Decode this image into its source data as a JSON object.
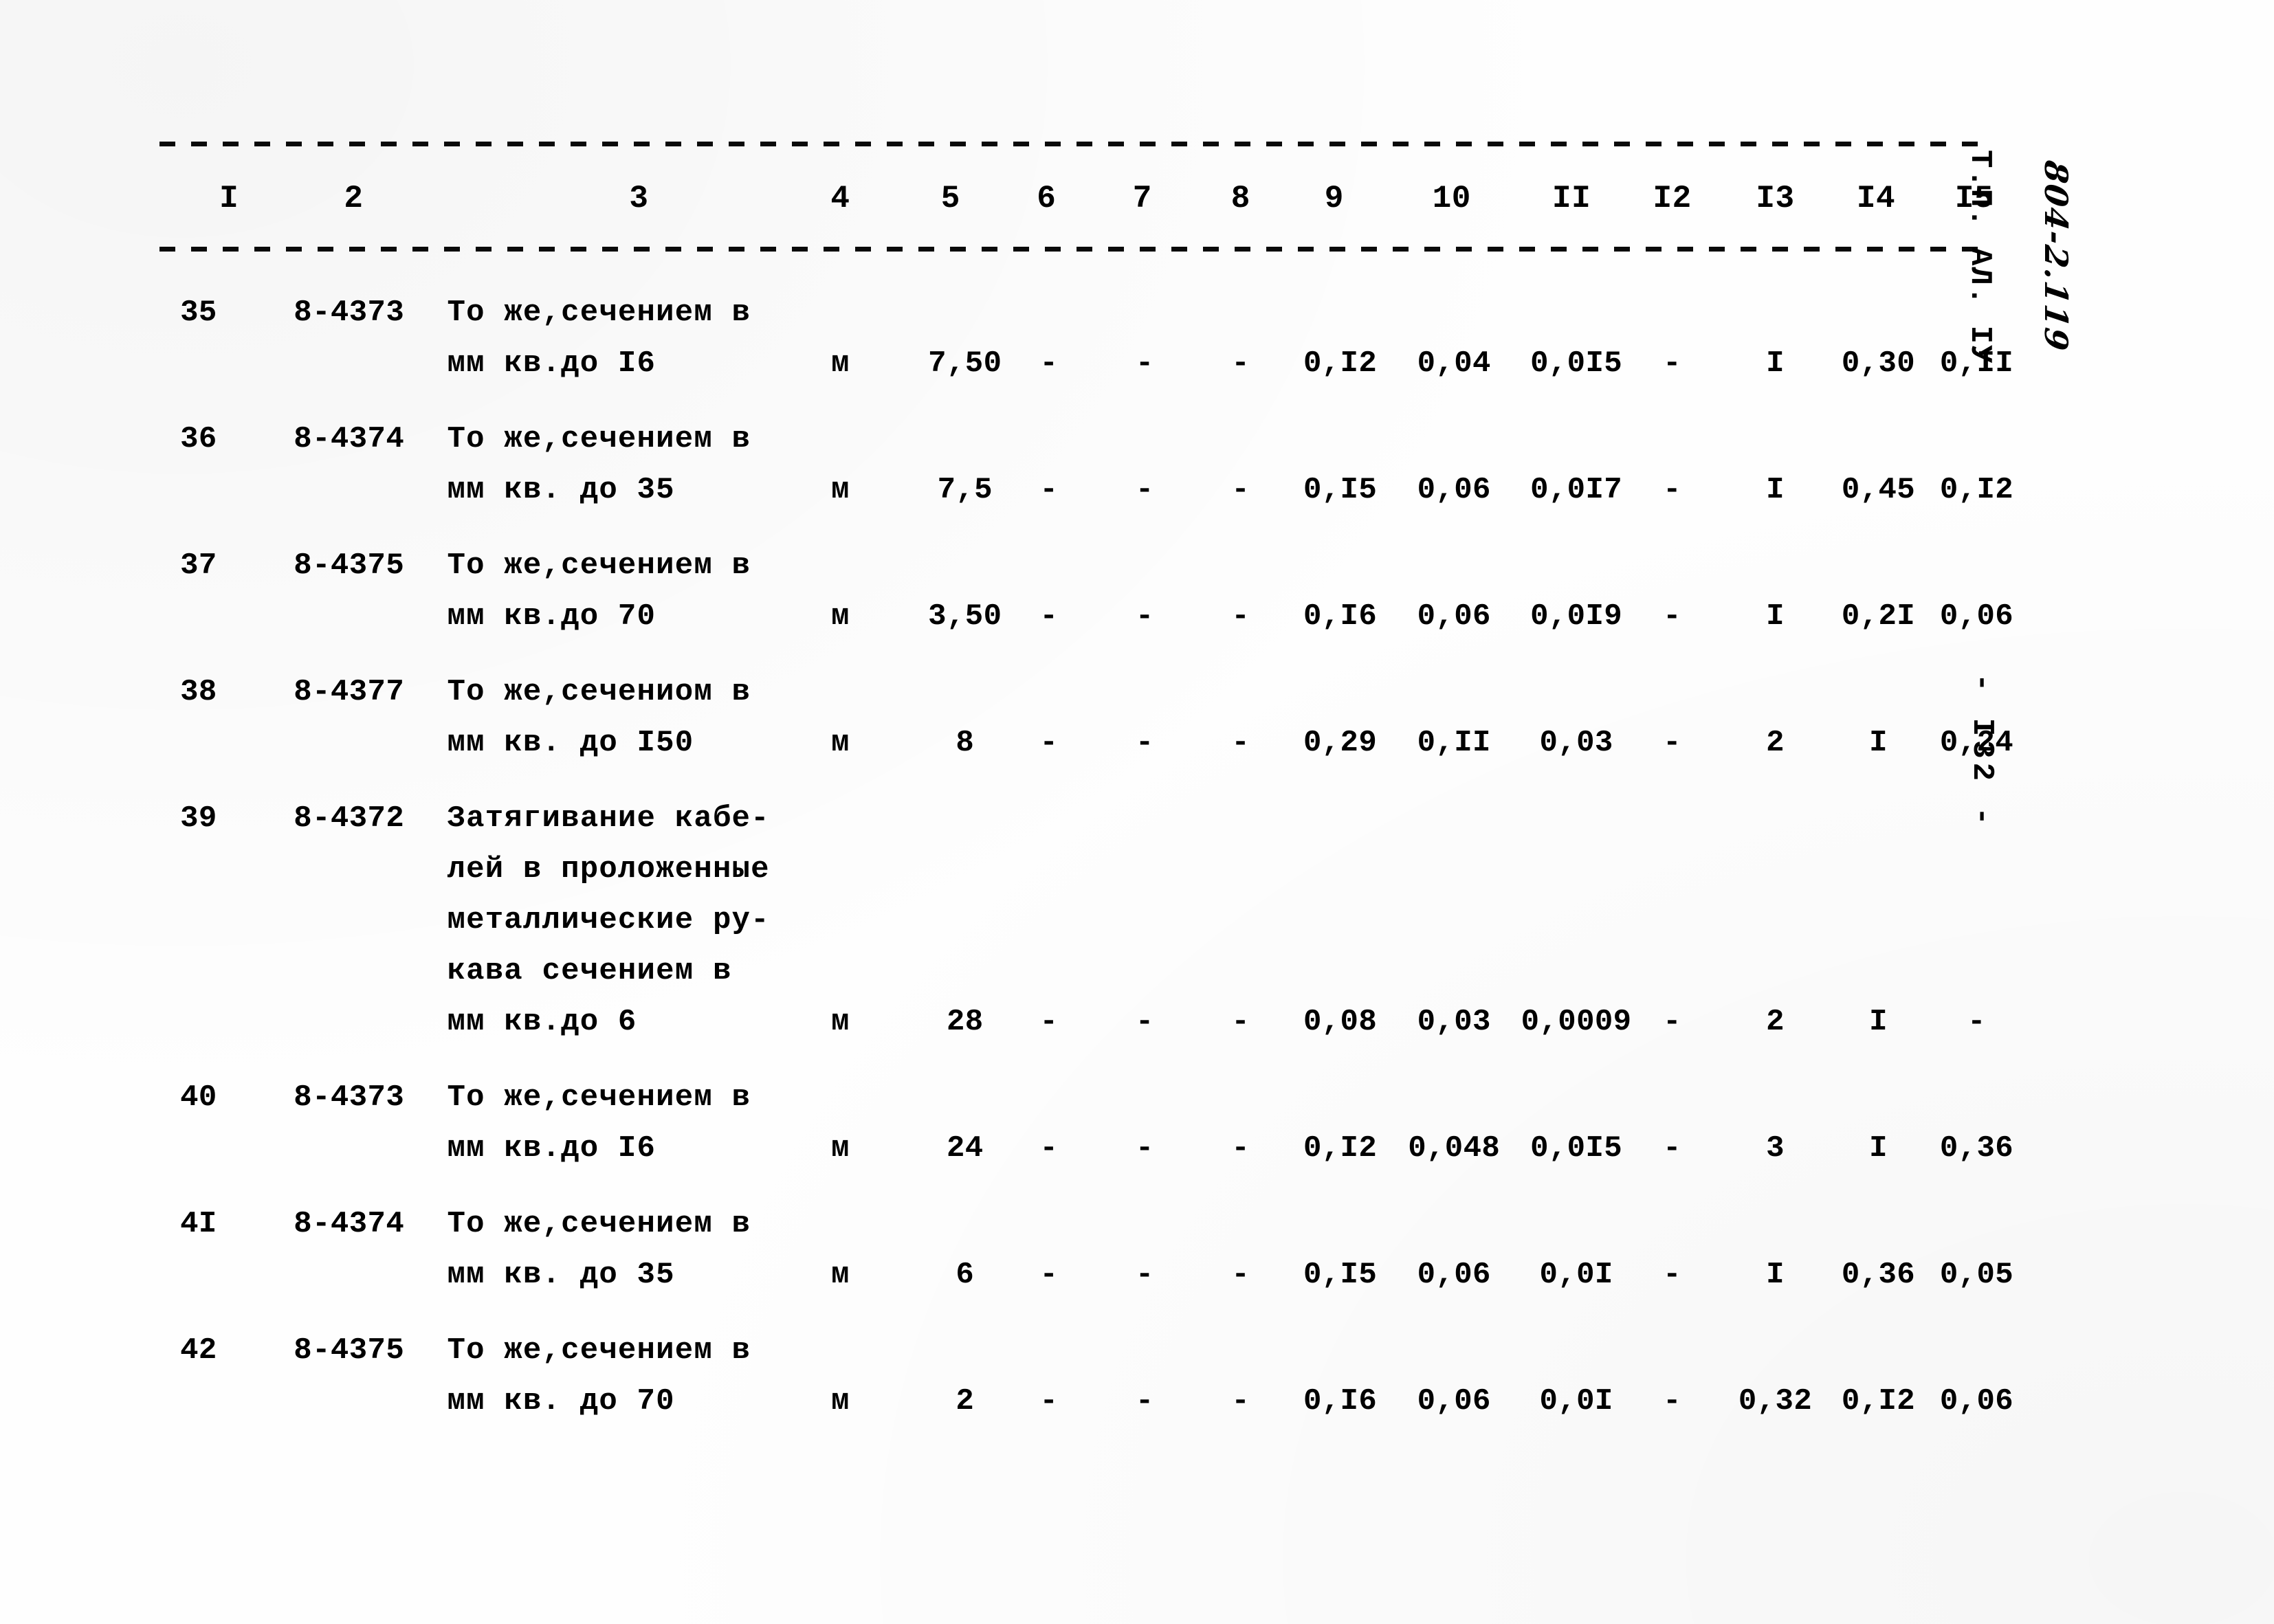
{
  "document": {
    "kind": "scanned-typewritten-table",
    "page_marker": "- I32 -",
    "stamp_vertical": "Т.П. АЛ. IУ",
    "stamp_handwritten": "804-2.119"
  },
  "table": {
    "column_headers": [
      "I",
      "2",
      "3",
      "4",
      "5",
      "6",
      "7",
      "8",
      "9",
      "10",
      "II",
      "I2",
      "I3",
      "I4",
      "I5"
    ],
    "rows": [
      {
        "no": "35",
        "code": "8-4373",
        "desc_lines": [
          "То же,сечением в",
          "мм кв.до I6"
        ],
        "unit": "м",
        "c5": "7,50",
        "c6": "-",
        "c7": "-",
        "c8": "-",
        "c9": "0,I2",
        "c10": "0,04",
        "c11": "0,0I5",
        "c12": "-",
        "c13": "I",
        "c14": "0,30",
        "c15": "0,II"
      },
      {
        "no": "36",
        "code": "8-4374",
        "desc_lines": [
          "То же,сечением в",
          "мм кв. до 35"
        ],
        "unit": "м",
        "c5": "7,5",
        "c6": "-",
        "c7": "-",
        "c8": "-",
        "c9": "0,I5",
        "c10": "0,06",
        "c11": "0,0I7",
        "c12": "-",
        "c13": "I",
        "c14": "0,45",
        "c15": "0,I2"
      },
      {
        "no": "37",
        "code": "8-4375",
        "desc_lines": [
          "То же,сечением в",
          "мм кв.до 70"
        ],
        "unit": "м",
        "c5": "3,50",
        "c6": "-",
        "c7": "-",
        "c8": "-",
        "c9": "0,I6",
        "c10": "0,06",
        "c11": "0,0I9",
        "c12": "-",
        "c13": "I",
        "c14": "0,2I",
        "c15": "0,06"
      },
      {
        "no": "38",
        "code": "8-4377",
        "desc_lines": [
          "То же,сечениом в",
          "мм кв. до I50"
        ],
        "unit": "м",
        "c5": "8",
        "c6": "-",
        "c7": "-",
        "c8": "-",
        "c9": "0,29",
        "c10": "0,II",
        "c11": "0,03",
        "c12": "-",
        "c13": "2",
        "c14": "I",
        "c15": "0,24"
      },
      {
        "no": "39",
        "code": "8-4372",
        "desc_lines": [
          "Затягивание кабе-",
          "лей в проложенные",
          "металлические ру-",
          "кава сечением в",
          "мм кв.до 6"
        ],
        "unit": "м",
        "c5": "28",
        "c6": "-",
        "c7": "-",
        "c8": "-",
        "c9": "0,08",
        "c10": "0,03",
        "c11": "0,0009",
        "c12": "-",
        "c13": "2",
        "c14": "I",
        "c15": "-"
      },
      {
        "no": "40",
        "code": "8-4373",
        "desc_lines": [
          "То же,сечением в",
          "мм кв.до I6"
        ],
        "unit": "м",
        "c5": "24",
        "c6": "-",
        "c7": "-",
        "c8": "-",
        "c9": "0,I2",
        "c10": "0,048",
        "c11": "0,0I5",
        "c12": "-",
        "c13": "3",
        "c14": "I",
        "c15": "0,36"
      },
      {
        "no": "41",
        "code": "8-4374",
        "desc_lines": [
          "То же,сечением в",
          "мм кв. до 35"
        ],
        "unit": "м",
        "c5": "6",
        "c6": "-",
        "c7": "-",
        "c8": "-",
        "c9": "0,I5",
        "c10": "0,06",
        "c11": "0,0I",
        "c12": "-",
        "c13": "I",
        "c14": "0,36",
        "c15": "0,05"
      },
      {
        "no": "42",
        "code": "8-4375",
        "desc_lines": [
          "То же,сечением в",
          "мм кв. до 70"
        ],
        "unit": "м",
        "c5": "2",
        "c6": "-",
        "c7": "-",
        "c8": "-",
        "c9": "0,I6",
        "c10": "0,06",
        "c11": "0,0I",
        "c12": "-",
        "c13": "0,32",
        "c14": "0,I2",
        "c15": "0,06"
      }
    ]
  },
  "row_number_labels": {
    "41_typed": "4I"
  }
}
